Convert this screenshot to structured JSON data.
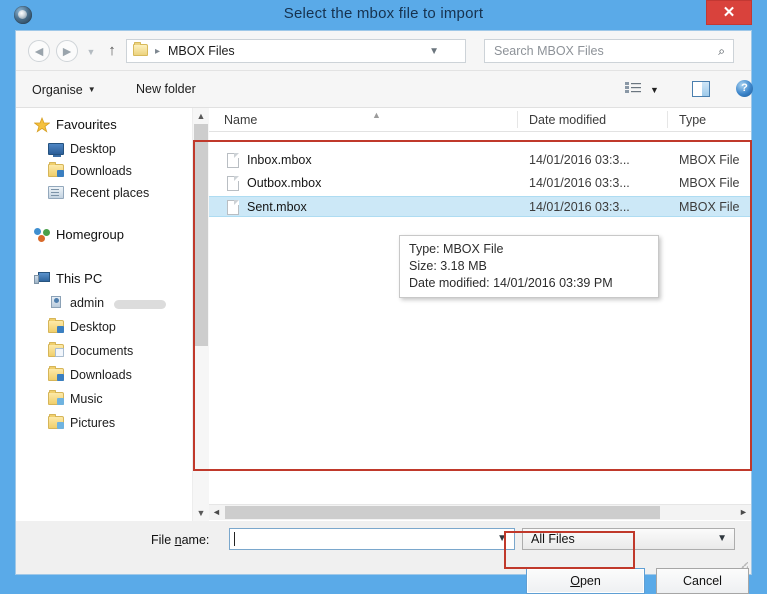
{
  "window": {
    "title": "Select the mbox file to import",
    "close_label": "✕",
    "accent_blue": "#5aaae8",
    "annotation_red": "#c0392b",
    "selection_blue": "#cce8f7"
  },
  "navbar": {
    "back_icon": "◄",
    "forward_icon": "►",
    "recent_icon": "▼",
    "up_icon": "↑",
    "path_separator": "▸",
    "path": "MBOX Files",
    "path_chevron": "▼",
    "refresh_icon": "↻",
    "search_placeholder": "Search MBOX Files",
    "search_icon": "⌕"
  },
  "toolbar": {
    "organise_label": "Organise",
    "organise_caret": "▼",
    "new_folder_label": "New folder",
    "view_caret": "▼",
    "help_label": "?"
  },
  "sidebar": {
    "items": [
      {
        "label": "Favourites",
        "icon": "star-icon",
        "level": 0
      },
      {
        "label": "Desktop",
        "icon": "monitor-icon",
        "level": 1
      },
      {
        "label": "Downloads",
        "icon": "folder-download-icon",
        "level": 1
      },
      {
        "label": "Recent places",
        "icon": "recent-places-icon",
        "level": 1
      },
      {
        "label": "Homegroup",
        "icon": "homegroup-icon",
        "level": 0
      },
      {
        "label": "This PC",
        "icon": "this-pc-icon",
        "level": 0
      },
      {
        "label": "admin",
        "icon": "user-folder-icon",
        "level": 1
      },
      {
        "label": "Desktop",
        "icon": "folder-desktop-icon",
        "level": 1
      },
      {
        "label": "Documents",
        "icon": "folder-documents-icon",
        "level": 1
      },
      {
        "label": "Downloads",
        "icon": "folder-download-icon",
        "level": 1
      },
      {
        "label": "Music",
        "icon": "folder-music-icon",
        "level": 1
      },
      {
        "label": "Pictures",
        "icon": "folder-pictures-icon",
        "level": 1
      }
    ],
    "scroll_up_icon": "▲",
    "scroll_down_icon": "▼"
  },
  "filelist": {
    "columns": [
      "Name",
      "Date modified",
      "Type"
    ],
    "sort_marker": "▲",
    "rows": [
      {
        "name": "Inbox.mbox",
        "date": "14/01/2016 03:3...",
        "type": "MBOX File",
        "selected": false
      },
      {
        "name": "Outbox.mbox",
        "date": "14/01/2016 03:3...",
        "type": "MBOX File",
        "selected": false
      },
      {
        "name": "Sent.mbox",
        "date": "14/01/2016 03:3...",
        "type": "MBOX File",
        "selected": true
      }
    ]
  },
  "tooltip": {
    "line1": "Type: MBOX File",
    "line2": "Size: 3.18 MB",
    "line3": "Date modified: 14/01/2016 03:39 PM"
  },
  "hscroll": {
    "left_icon": "◄",
    "right_icon": "►"
  },
  "bottom": {
    "filename_label_pre": "File ",
    "filename_label_mnemonic": "n",
    "filename_label_post": "ame:",
    "filename_value": "",
    "filename_chevron": "▼",
    "filter_value": "All Files",
    "filter_chevron": "▼",
    "open_label_pre": "",
    "open_label_mnemonic": "O",
    "open_label_post": "pen",
    "cancel_label": "Cancel"
  }
}
